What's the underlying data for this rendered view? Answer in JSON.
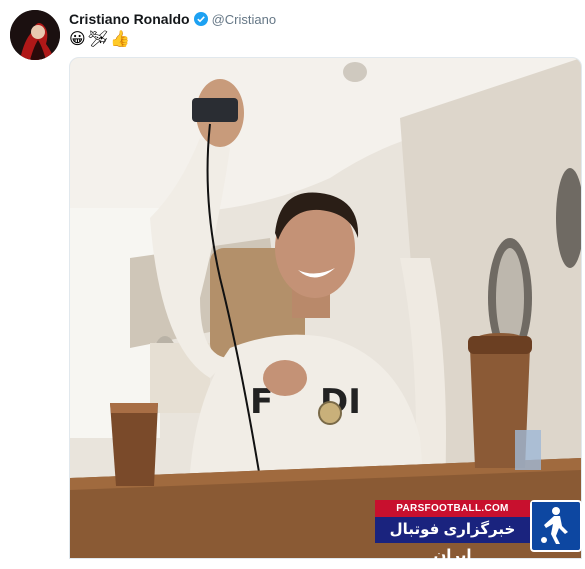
{
  "tweet": {
    "display_name": "Cristiano Ronaldo",
    "handle": "@Cristiano",
    "emojis": [
      "😀",
      "🛩",
      "👍"
    ],
    "avatar_icon": "avatar-portrait",
    "verified_icon": "verified-badge-icon"
  },
  "watermark": {
    "site": "PARSFOOTBALL.COM",
    "tagline": "خبرگزاری فوتبال ایران",
    "logo_icon": "football-player-logo"
  },
  "colors": {
    "name": "#14171a",
    "handle": "#657786",
    "verified": "#1da1f2",
    "watermark_red": "#c8102e",
    "watermark_blue": "#1a237e"
  }
}
